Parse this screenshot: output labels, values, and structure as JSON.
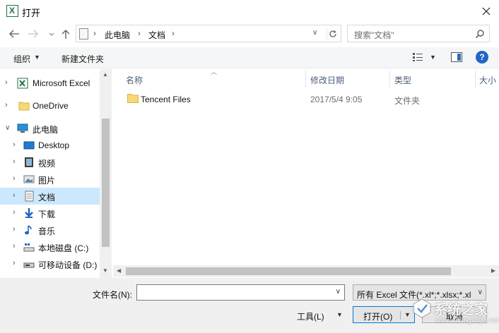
{
  "window": {
    "title": "打开"
  },
  "address": {
    "crumbs": [
      "此电脑",
      "文档"
    ]
  },
  "search": {
    "placeholder": "搜索\"文档\""
  },
  "toolbar": {
    "organize": "组织",
    "new_folder": "新建文件夹",
    "help": "?"
  },
  "sidebar": {
    "items": [
      {
        "label": "Microsoft Excel",
        "icon": "excel-icon"
      },
      {
        "label": "OneDrive",
        "icon": "folder-icon"
      },
      {
        "label": "此电脑",
        "icon": "computer-icon"
      },
      {
        "label": "Desktop",
        "icon": "desktop-icon"
      },
      {
        "label": "视频",
        "icon": "video-icon"
      },
      {
        "label": "图片",
        "icon": "picture-icon"
      },
      {
        "label": "文档",
        "icon": "document-icon",
        "selected": true
      },
      {
        "label": "下载",
        "icon": "download-icon"
      },
      {
        "label": "音乐",
        "icon": "music-icon"
      },
      {
        "label": "本地磁盘 (C:)",
        "icon": "drive-icon"
      },
      {
        "label": "可移动设备 (D:)",
        "icon": "removable-drive-icon"
      }
    ]
  },
  "list": {
    "columns": [
      "名称",
      "修改日期",
      "类型",
      "大小"
    ],
    "rows": [
      {
        "name": "Tencent Files",
        "date": "2017/5/4 9:05",
        "type": "文件夹"
      }
    ]
  },
  "footer": {
    "filename_label": "文件名(N):",
    "filename_value": "",
    "filter": "所有 Excel 文件(*.xl*;*.xlsx;*.xl",
    "tools": "工具(L)",
    "open": "打开(O)",
    "cancel": "取消"
  },
  "watermark": {
    "text": "系统之家",
    "url": "www.xitongzhijia.net"
  },
  "colors": {
    "selection": "#cce8ff",
    "accent": "#0078d7",
    "excel_green": "#1d7044"
  }
}
